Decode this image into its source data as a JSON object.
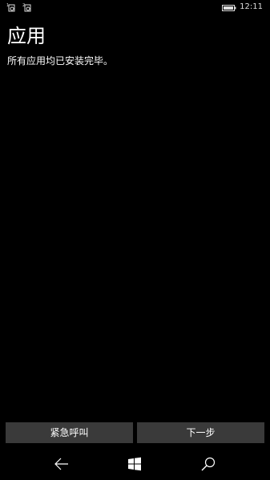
{
  "status_bar": {
    "sim1_icon": "sim-1-no-signal-icon",
    "sim2_icon": "sim-2-no-signal-icon",
    "battery_icon": "battery-full-icon",
    "time": "12:11"
  },
  "page": {
    "title": "应用",
    "subtitle": "所有应用均已安装完毕。"
  },
  "buttons": {
    "emergency_label": "紧急呼叫",
    "next_label": "下一步"
  },
  "nav_bar": {
    "back_icon": "back-arrow-icon",
    "start_icon": "windows-start-icon",
    "search_icon": "search-icon"
  },
  "colors": {
    "background": "#000000",
    "button_bg": "#3a3a3a",
    "text": "#ffffff"
  }
}
